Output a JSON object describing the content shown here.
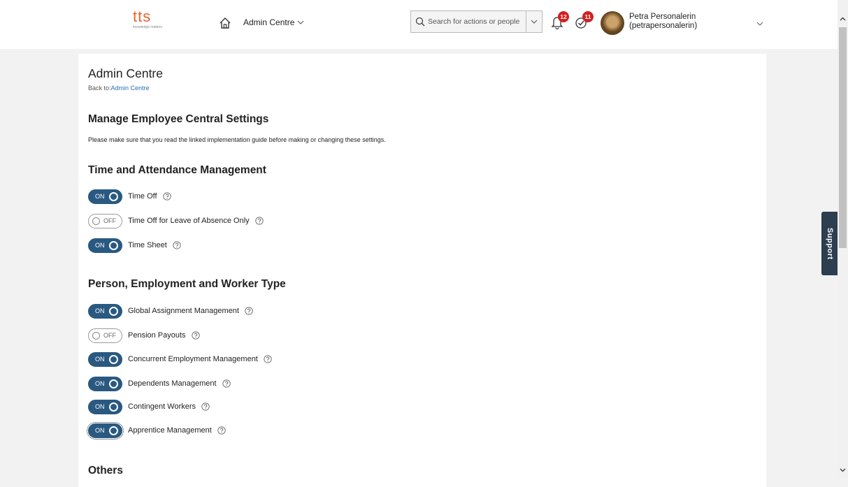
{
  "header": {
    "logo_text": "tts",
    "logo_tagline": "knowledge matters",
    "nav_label": "Admin Centre",
    "search_placeholder": "Search for actions or people",
    "notifications_count": "12",
    "tasks_count": "11",
    "user_name": "Petra Personalerin",
    "user_id": "(petrapersonalerin)"
  },
  "page": {
    "title": "Admin Centre",
    "back_prefix": "Back to:",
    "back_link": "Admin Centre",
    "section_title": "Manage Employee Central Settings",
    "note": "Please make sure that you read the linked implementation guide before making or changing these settings."
  },
  "groups": [
    {
      "title": "Time and Attendance Management",
      "items": [
        {
          "label": "Time Off",
          "state": "ON"
        },
        {
          "label": "Time Off for Leave of Absence Only",
          "state": "OFF"
        },
        {
          "label": "Time Sheet",
          "state": "ON"
        }
      ]
    },
    {
      "title": "Person, Employment and Worker Type",
      "items": [
        {
          "label": "Global Assignment Management",
          "state": "ON"
        },
        {
          "label": "Pension Payouts",
          "state": "OFF"
        },
        {
          "label": "Concurrent Employment Management",
          "state": "ON"
        },
        {
          "label": "Dependents Management",
          "state": "ON"
        },
        {
          "label": "Contingent Workers",
          "state": "ON"
        },
        {
          "label": "Apprentice Management",
          "state": "ON"
        }
      ]
    },
    {
      "title": "Others",
      "items": []
    }
  ],
  "support_label": "Support",
  "colors": {
    "toggle_on": "#295981",
    "logo": "#e8612c",
    "link": "#2a6fb0",
    "badge": "#d32020"
  }
}
